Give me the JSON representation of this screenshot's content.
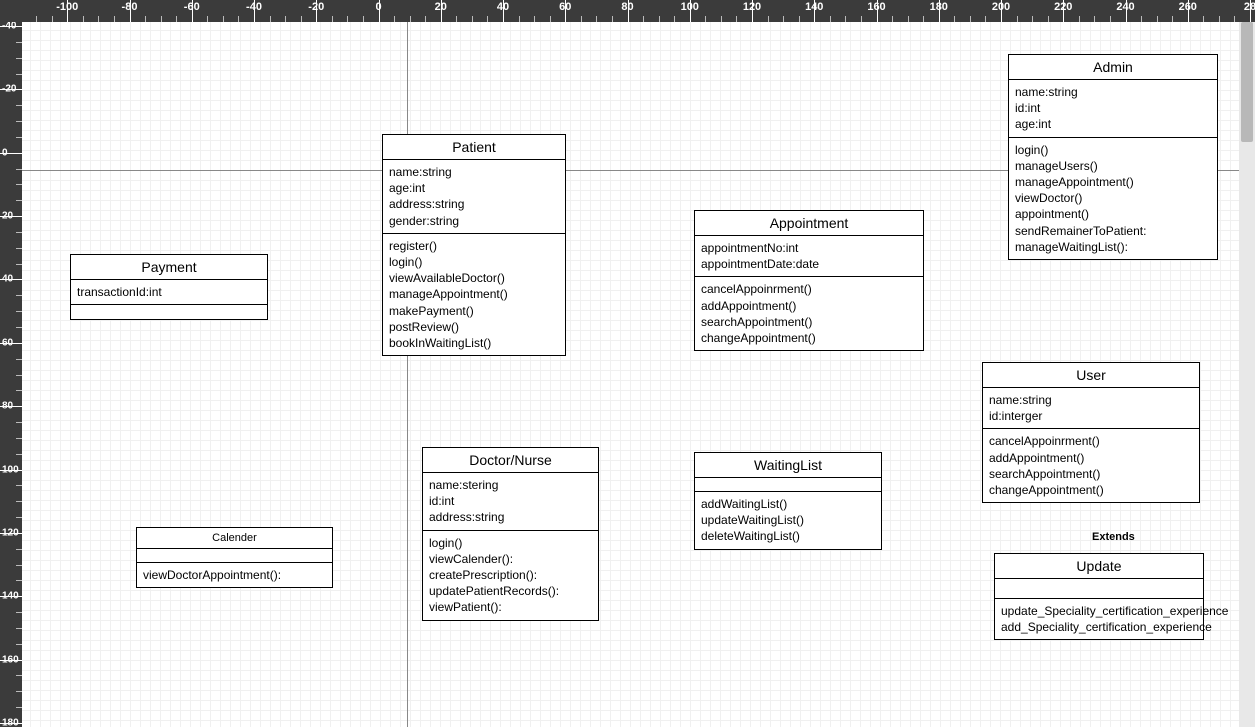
{
  "rulers": {
    "horizontal": [
      "0",
      "-100",
      "-80",
      "-60",
      "-40",
      "-20",
      "0",
      "20",
      "40",
      "60",
      "80",
      "100",
      "120",
      "140",
      "160",
      "180",
      "200",
      "220",
      "240",
      "260",
      "28"
    ],
    "vertical": [
      "-40",
      "-20",
      "0",
      "20",
      "40",
      "60",
      "80",
      "100",
      "120",
      "140",
      "160",
      "180"
    ]
  },
  "classes": {
    "patient": {
      "title": "Patient",
      "attrs": "name:string\nage:int\naddress:string\ngender:string",
      "ops": "register()\nlogin()\nviewAvailableDoctor()\nmanageAppointment()\nmakePayment()\npostReview()\nbookInWaitingList()"
    },
    "payment": {
      "title": "Payment",
      "attrs": "transactionId:int",
      "ops": ""
    },
    "appointment": {
      "title": "Appointment",
      "attrs": "appointmentNo:int\nappointmentDate:date",
      "ops": "cancelAppoinrment()\naddAppointment()\nsearchAppointment()\nchangeAppointment()"
    },
    "admin": {
      "title": "Admin",
      "attrs": "name:string\nid:int\nage:int",
      "ops": "login()\nmanageUsers()\nmanageAppointment()\nviewDoctor()\nappointment()\nsendRemainerToPatient:\nmanageWaitingList():"
    },
    "doctor": {
      "title": "Doctor/Nurse",
      "attrs": "name:stering\nid:int\naddress:string",
      "ops": "login()\nviewCalender():\ncreatePrescription():\nupdatePatientRecords():\nviewPatient():"
    },
    "waiting": {
      "title": "WaitingList",
      "attrs": "",
      "ops": "addWaitingList()\nupdateWaitingList()\ndeleteWaitingList()"
    },
    "user": {
      "title": "User",
      "attrs": "name:string\nid:interger",
      "ops": "cancelAppoinrment()\naddAppointment()\nsearchAppointment()\nchangeAppointment()"
    },
    "calender": {
      "title": "Calender",
      "attrs": "",
      "ops": "viewDoctorAppointment():"
    },
    "update": {
      "title": "Update",
      "attrs": "",
      "ops": "update_Speciality_certification_experience\nadd_Speciality_certification_experience"
    }
  },
  "labels": {
    "extends": "Extends"
  }
}
